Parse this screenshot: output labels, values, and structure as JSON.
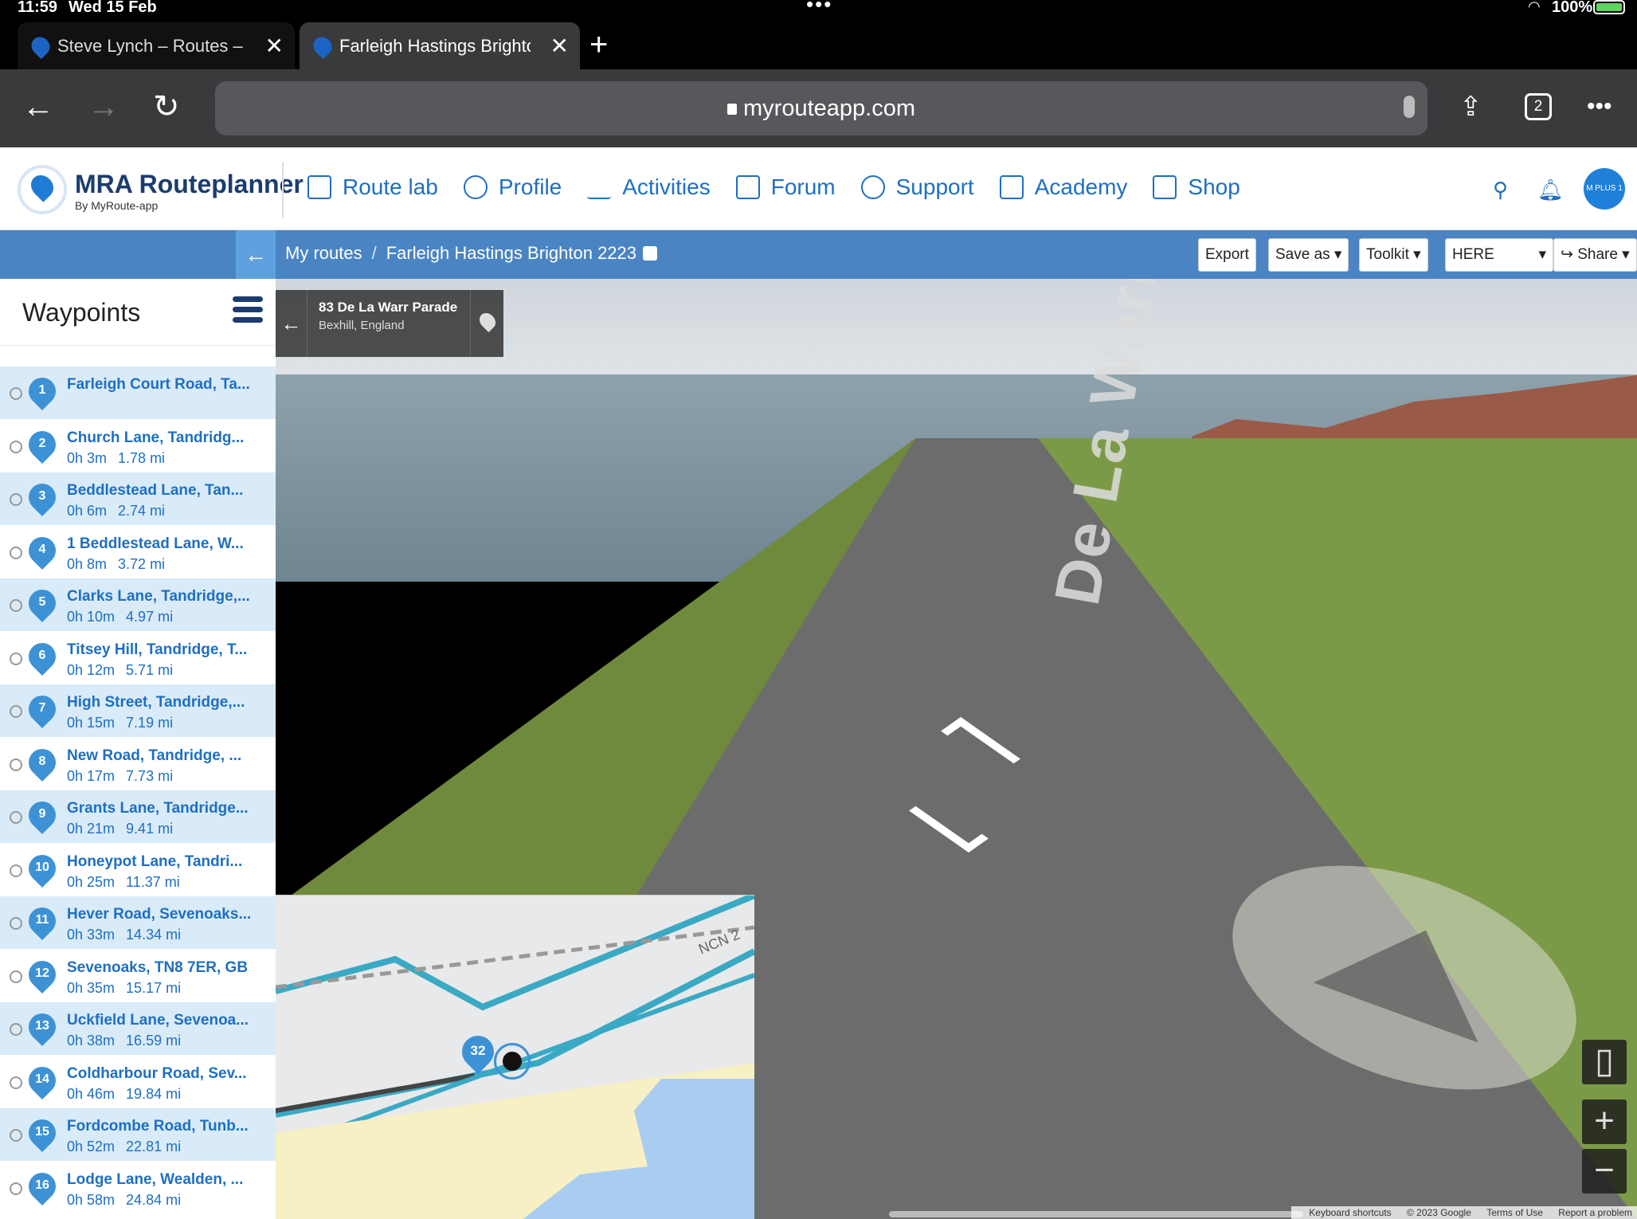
{
  "status_bar": {
    "time": "11:59",
    "date": "Wed 15 Feb",
    "battery": "100%"
  },
  "browser": {
    "tabs": [
      {
        "title": "Steve Lynch – Routes – M"
      },
      {
        "title": "Farleigh Hastings Brighto"
      }
    ],
    "url": "myrouteapp.com",
    "tab_count": "2"
  },
  "app": {
    "brand_name": "MRA Routeplanner",
    "brand_sub": "By MyRoute-app",
    "nav": [
      {
        "label": "Route lab",
        "icon": "book-icon"
      },
      {
        "label": "Profile",
        "icon": "user-icon"
      },
      {
        "label": "Activities",
        "icon": "pulse-icon"
      },
      {
        "label": "Forum",
        "icon": "chat-icon"
      },
      {
        "label": "Support",
        "icon": "headset-icon"
      },
      {
        "label": "Academy",
        "icon": "graduation-cap-icon"
      },
      {
        "label": "Shop",
        "icon": "shopping-bag-icon"
      }
    ],
    "avatar_label": "M PLUS 1"
  },
  "routebar": {
    "breadcrumb_root": "My routes",
    "separator": "/",
    "route_name": "Farleigh Hastings Brighton 2223",
    "buttons": {
      "export": "Export",
      "save_as": "Save as",
      "toolkit": "Toolkit",
      "map_provider": "HERE",
      "share": "Share"
    }
  },
  "sidebar": {
    "title": "Waypoints",
    "waypoints": [
      {
        "num": "1",
        "name": "Farleigh Court Road, Ta...",
        "time": "",
        "dist": ""
      },
      {
        "num": "2",
        "name": "Church Lane, Tandridg...",
        "time": "0h 3m",
        "dist": "1.78 mi"
      },
      {
        "num": "3",
        "name": "Beddlestead Lane, Tan...",
        "time": "0h 6m",
        "dist": "2.74 mi"
      },
      {
        "num": "4",
        "name": "1 Beddlestead Lane, W...",
        "time": "0h 8m",
        "dist": "3.72 mi"
      },
      {
        "num": "5",
        "name": "Clarks Lane, Tandridge,...",
        "time": "0h 10m",
        "dist": "4.97 mi"
      },
      {
        "num": "6",
        "name": "Titsey Hill, Tandridge, T...",
        "time": "0h 12m",
        "dist": "5.71 mi"
      },
      {
        "num": "7",
        "name": "High Street, Tandridge,...",
        "time": "0h 15m",
        "dist": "7.19 mi"
      },
      {
        "num": "8",
        "name": "New Road, Tandridge, ...",
        "time": "0h 17m",
        "dist": "7.73 mi"
      },
      {
        "num": "9",
        "name": "Grants Lane, Tandridge...",
        "time": "0h 21m",
        "dist": "9.41 mi"
      },
      {
        "num": "10",
        "name": "Honeypot Lane, Tandri...",
        "time": "0h 25m",
        "dist": "11.37 mi"
      },
      {
        "num": "11",
        "name": "Hever Road, Sevenoaks...",
        "time": "0h 33m",
        "dist": "14.34 mi"
      },
      {
        "num": "12",
        "name": "Sevenoaks, TN8 7ER, GB",
        "time": "0h 35m",
        "dist": "15.17 mi"
      },
      {
        "num": "13",
        "name": "Uckfield Lane, Sevenoa...",
        "time": "0h 38m",
        "dist": "16.59 mi"
      },
      {
        "num": "14",
        "name": "Coldharbour Road, Sev...",
        "time": "0h 46m",
        "dist": "19.84 mi"
      },
      {
        "num": "15",
        "name": "Fordcombe Road, Tunb...",
        "time": "0h 52m",
        "dist": "22.81 mi"
      },
      {
        "num": "16",
        "name": "Lodge Lane, Wealden, ...",
        "time": "0h 58m",
        "dist": "24.84 mi"
      }
    ]
  },
  "streetview": {
    "address_line1": "83 De La Warr Parade",
    "address_line2": "Bexhill, England",
    "road_label": "De La Warr Parade",
    "footer": [
      "Keyboard shortcuts",
      "© 2023 Google",
      "Terms of Use",
      "Report a problem"
    ]
  },
  "minimap": {
    "waypoint_num": "32",
    "road_label": "NCN 2"
  }
}
